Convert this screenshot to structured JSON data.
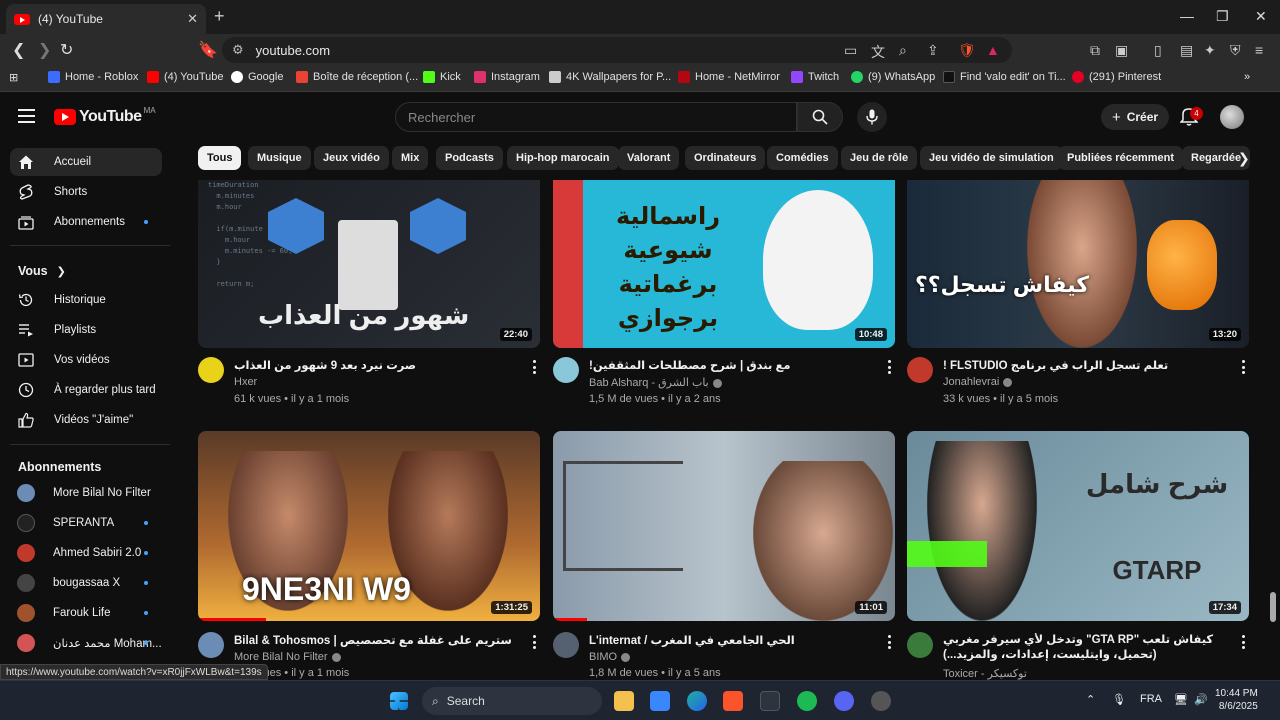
{
  "browser": {
    "tab_title": "(4) YouTube",
    "url": "youtube.com",
    "status_url": "https://www.youtube.com/watch?v=xR0jjFxWLBw&t=139s",
    "bookmarks": [
      {
        "label": "Home - Roblox",
        "color": "#3b6cff"
      },
      {
        "label": "(4) YouTube",
        "color": "#ff0000"
      },
      {
        "label": "Google",
        "color": "#ffffff"
      },
      {
        "label": "Boîte de réception (...",
        "color": "#ea4335"
      },
      {
        "label": "Kick",
        "color": "#53fc18"
      },
      {
        "label": "Instagram",
        "color": "#e1306c"
      },
      {
        "label": "4K Wallpapers for P...",
        "color": "#cccccc"
      },
      {
        "label": "Home - NetMirror",
        "color": "#b20710"
      },
      {
        "label": "Twitch",
        "color": "#9146ff"
      },
      {
        "label": "(9) WhatsApp",
        "color": "#25d366"
      },
      {
        "label": "Find 'valo edit' on Ti...",
        "color": "#111111"
      },
      {
        "label": "(291) Pinterest",
        "color": "#e60023"
      }
    ]
  },
  "header": {
    "logo_text": "YouTube",
    "region": "MA",
    "search_placeholder": "Rechercher",
    "create_label": "Créer",
    "notif_count": "4"
  },
  "sidebar": {
    "main": [
      {
        "label": "Accueil",
        "icon": "home-icon"
      },
      {
        "label": "Shorts",
        "icon": "shorts-icon"
      },
      {
        "label": "Abonnements",
        "icon": "subscriptions-icon"
      }
    ],
    "you_header": "Vous",
    "you": [
      {
        "label": "Historique",
        "icon": "history-icon"
      },
      {
        "label": "Playlists",
        "icon": "playlists-icon"
      },
      {
        "label": "Vos vidéos",
        "icon": "your-videos-icon"
      },
      {
        "label": "À regarder plus tard",
        "icon": "watch-later-icon"
      },
      {
        "label": "Vidéos \"J'aime\"",
        "icon": "liked-icon"
      }
    ],
    "subs_header": "Abonnements",
    "subs": [
      {
        "label": "More Bilal No Filter",
        "color": "#6b8db5"
      },
      {
        "label": "SPERANTA",
        "color": "#222222"
      },
      {
        "label": "Ahmed Sabiri 2.0",
        "color": "#c0392b"
      },
      {
        "label": "bougassaa X",
        "color": "#444444"
      },
      {
        "label": "Farouk Life",
        "color": "#a0522d"
      },
      {
        "label": "محمد عدنان Moham...",
        "color": "#d35454"
      }
    ]
  },
  "chips": [
    "Tous",
    "Musique",
    "Jeux vidéo",
    "Mix",
    "Podcasts",
    "Hip-hop marocain",
    "Valorant",
    "Ordinateurs",
    "Comédies",
    "Jeu de rôle",
    "Jeu vidéo de simulation",
    "Publiées récemment",
    "Regardée"
  ],
  "videos": [
    {
      "title": "صرت نيرد بعد 9 شهور من العذاب",
      "channel": "Hxer",
      "meta": "61 k vues • il y a 1 mois",
      "duration": "22:40",
      "thumb_text": "شهور من العذاب",
      "verified": false
    },
    {
      "title": "مع بندق | شرح مصطلحات المثقفين!",
      "channel": "Bab Alsharq - باب الشرق",
      "meta": "1,5 M de vues • il y a 2 ans",
      "duration": "10:48",
      "thumb_text": "راسمالية شيوعية برغماتية برجوازي",
      "verified": true
    },
    {
      "title": "تعلم تسجل الراب في برنامج FLSTUDIO !",
      "channel": "Jonahlevrai",
      "meta": "33 k vues • il y a 5 mois",
      "duration": "13:20",
      "thumb_text": "كيفاش تسجل؟؟",
      "verified": true
    },
    {
      "title": "ستريم على غفلة مع تحصصيص | Bilal & Tohosmos",
      "channel": "More Bilal No Filter",
      "meta": "vues • il y a 1 mois",
      "duration": "1:31:25",
      "thumb_text": "9NE3NI W9",
      "verified": true
    },
    {
      "title": "الحي الجامعي في المغرب / L'internat",
      "channel": "BIMO",
      "meta": "1,8 M de vues • il y a 5 ans",
      "duration": "11:01",
      "thumb_text": "",
      "verified": true
    },
    {
      "title": "كيفاش تلعب \"GTA RP\" وتدخل لأي سيرفر مغربي (تحميل، وايتليست، إعدادات، والمزيد...)",
      "channel": "Toxicer - توكسيكر",
      "meta": "",
      "duration": "17:34",
      "thumb_text": "شرح شامل GTARP",
      "verified": false
    }
  ],
  "taskbar": {
    "search_label": "Search",
    "lang": "FRA",
    "time": "10:44 PM",
    "date": "8/6/2025"
  }
}
